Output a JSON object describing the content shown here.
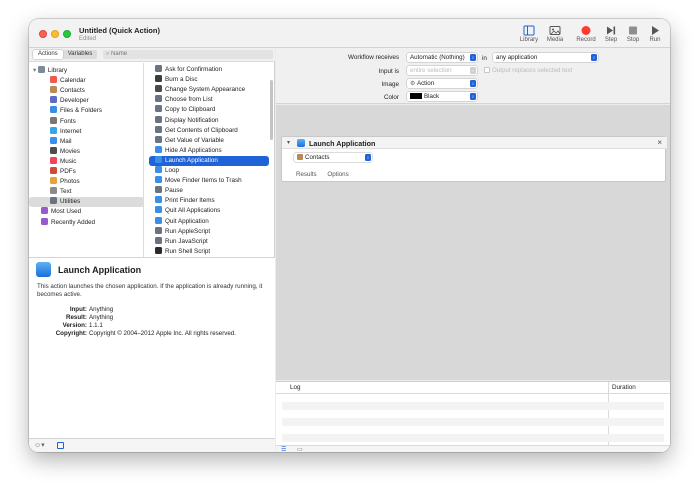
{
  "window": {
    "title": "Untitled (Quick Action)",
    "subtitle": "Edited"
  },
  "toolbar": [
    {
      "label": "Library",
      "icon": "library-icon"
    },
    {
      "label": "Media",
      "icon": "media-icon"
    },
    {
      "label": "Record",
      "icon": "record-icon",
      "color": "#ff3b30"
    },
    {
      "label": "Step",
      "icon": "step-icon"
    },
    {
      "label": "Stop",
      "icon": "stop-icon"
    },
    {
      "label": "Run",
      "icon": "run-icon"
    }
  ],
  "tabs": {
    "actions": "Actions",
    "variables": "Variables"
  },
  "search": {
    "placeholder": "Name"
  },
  "library": [
    {
      "label": "Library",
      "icon": "library-folder-icon",
      "color": "#7d8a99"
    },
    {
      "label": "Calendar",
      "icon": "calendar-icon",
      "color": "#f05a4f"
    },
    {
      "label": "Contacts",
      "icon": "contacts-icon",
      "color": "#b88a5a"
    },
    {
      "label": "Developer",
      "icon": "developer-icon",
      "color": "#5a6cc8"
    },
    {
      "label": "Files & Folders",
      "icon": "finder-icon",
      "color": "#3a8ee6"
    },
    {
      "label": "Fonts",
      "icon": "fonts-icon",
      "color": "#777777"
    },
    {
      "label": "Internet",
      "icon": "internet-icon",
      "color": "#3aa3e8"
    },
    {
      "label": "Mail",
      "icon": "mail-icon",
      "color": "#3c8ef0"
    },
    {
      "label": "Movies",
      "icon": "movies-icon",
      "color": "#4d4d4d"
    },
    {
      "label": "Music",
      "icon": "music-icon",
      "color": "#f2455c"
    },
    {
      "label": "PDFs",
      "icon": "pdf-icon",
      "color": "#d04a3a"
    },
    {
      "label": "Photos",
      "icon": "photos-icon",
      "color": "#e9a23b"
    },
    {
      "label": "Text",
      "icon": "text-icon",
      "color": "#8a8a8a"
    },
    {
      "label": "Utilities",
      "icon": "utilities-icon",
      "color": "#6a7480"
    },
    {
      "label": "Most Used",
      "icon": "smart-folder-icon",
      "color": "#9b59d0"
    },
    {
      "label": "Recently Added",
      "icon": "smart-folder-icon",
      "color": "#9b59d0"
    }
  ],
  "actions": [
    {
      "label": "Ask for Confirmation",
      "icon": "utilities-icon",
      "color": "#6a7480"
    },
    {
      "label": "Burn a Disc",
      "icon": "burn-icon",
      "color": "#3c3c3c"
    },
    {
      "label": "Change System Appearance",
      "icon": "appearance-icon",
      "color": "#4a4a4a"
    },
    {
      "label": "Choose from List",
      "icon": "utilities-icon",
      "color": "#6a7480"
    },
    {
      "label": "Copy to Clipboard",
      "icon": "utilities-icon",
      "color": "#6a7480"
    },
    {
      "label": "Display Notification",
      "icon": "utilities-icon",
      "color": "#6a7480"
    },
    {
      "label": "Get Contents of Clipboard",
      "icon": "utilities-icon",
      "color": "#6a7480"
    },
    {
      "label": "Get Value of Variable",
      "icon": "utilities-icon",
      "color": "#6a7480"
    },
    {
      "label": "Hide All Applications",
      "icon": "finder-icon",
      "color": "#3a8ee6"
    },
    {
      "label": "Launch Application",
      "icon": "finder-icon",
      "color": "#3a8ee6"
    },
    {
      "label": "Loop",
      "icon": "finder-icon",
      "color": "#3a8ee6"
    },
    {
      "label": "Move Finder Items to Trash",
      "icon": "finder-icon",
      "color": "#3a8ee6"
    },
    {
      "label": "Pause",
      "icon": "utilities-icon",
      "color": "#6a7480"
    },
    {
      "label": "Print Finder Items",
      "icon": "finder-icon",
      "color": "#3a8ee6"
    },
    {
      "label": "Quit All Applications",
      "icon": "finder-icon",
      "color": "#3a8ee6"
    },
    {
      "label": "Quit Application",
      "icon": "finder-icon",
      "color": "#3a8ee6"
    },
    {
      "label": "Run AppleScript",
      "icon": "utilities-icon",
      "color": "#6a7480"
    },
    {
      "label": "Run JavaScript",
      "icon": "utilities-icon",
      "color": "#6a7480"
    },
    {
      "label": "Run Shell Script",
      "icon": "terminal-icon",
      "color": "#2b2b2b"
    }
  ],
  "description": {
    "title": "Launch Application",
    "text": "This action launches the chosen application. If the application is already running, it becomes active.",
    "meta": [
      {
        "key": "Input:",
        "value": "Anything"
      },
      {
        "key": "Result:",
        "value": "Anything"
      },
      {
        "key": "Version:",
        "value": "1.1.1"
      },
      {
        "key": "Copyright:",
        "value": "Copyright © 2004–2012 Apple Inc.  All rights reserved."
      }
    ]
  },
  "workflow": {
    "receives_label": "Workflow receives",
    "receives_value": "Automatic (Nothing)",
    "in_label": "in",
    "in_value": "any application",
    "input_is_label": "Input is",
    "input_is_value": "entire selection",
    "replaces_label": "Output replaces selected text",
    "image_label": "Image",
    "image_value": "Action",
    "color_label": "Color",
    "color_value": "Black"
  },
  "action_card": {
    "title": "Launch Application",
    "app_value": "Contacts",
    "tab_results": "Results",
    "tab_options": "Options"
  },
  "log": {
    "log_label": "Log",
    "duration_label": "Duration"
  },
  "colors": {
    "accent": "#1f63d6",
    "selection_grey": "#dcdcdc"
  }
}
